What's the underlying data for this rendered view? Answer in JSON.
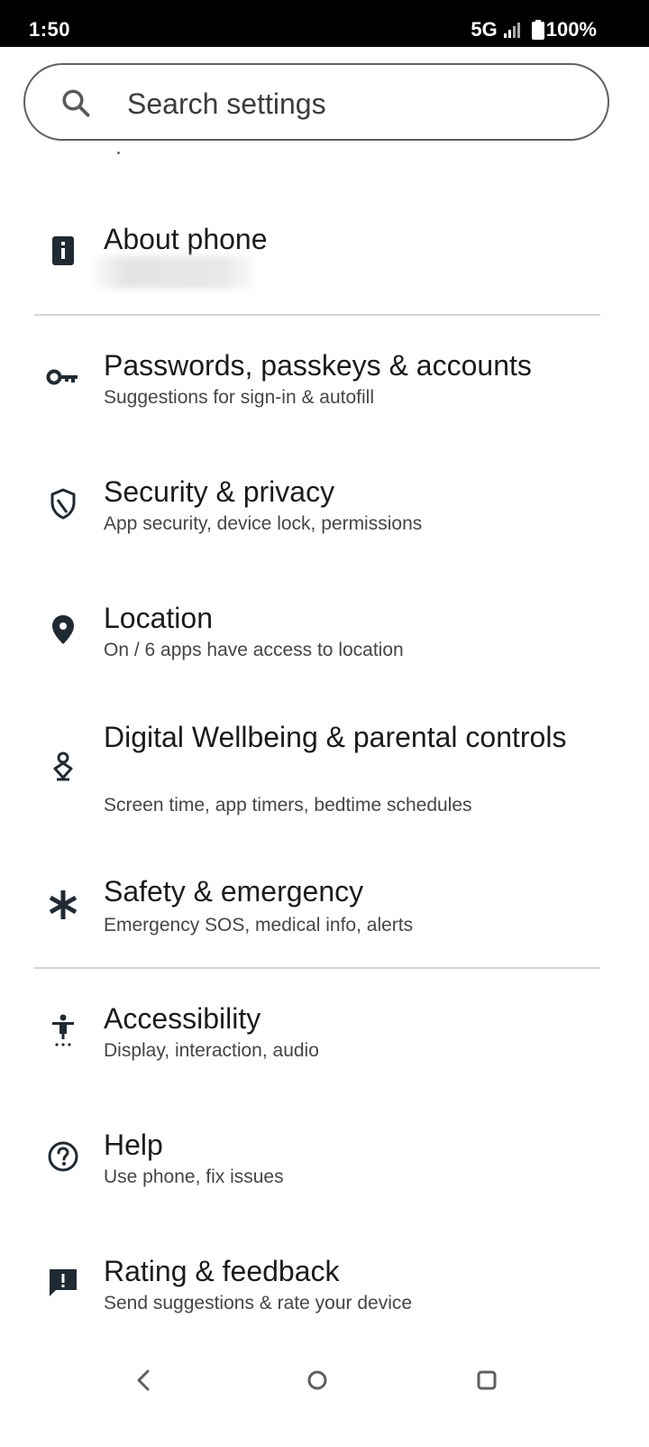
{
  "status_bar": {
    "time": "1:50",
    "network": "5G",
    "battery": "100%"
  },
  "search": {
    "placeholder": "Search settings"
  },
  "items": [
    {
      "title": "About phone",
      "subtitle": "",
      "icon": "info-icon"
    },
    {
      "title": "Passwords, passkeys & accounts",
      "subtitle": "Suggestions for sign-in & autofill",
      "icon": "key-icon"
    },
    {
      "title": "Security & privacy",
      "subtitle": "App security, device lock, permissions",
      "icon": "shield-icon"
    },
    {
      "title": "Location",
      "subtitle": "On / 6 apps have access to location",
      "icon": "location-pin-icon"
    },
    {
      "title": "Digital Wellbeing & parental controls",
      "subtitle": "Screen time, app timers, bedtime schedules",
      "icon": "wellbeing-icon"
    },
    {
      "title": "Safety & emergency",
      "subtitle": "Emergency SOS, medical info, alerts",
      "icon": "asterisk-icon"
    },
    {
      "title": "Accessibility",
      "subtitle": "Display, interaction, audio",
      "icon": "accessibility-icon"
    },
    {
      "title": "Help",
      "subtitle": "Use phone, fix issues",
      "icon": "help-icon"
    },
    {
      "title": "Rating & feedback",
      "subtitle": "Send suggestions & rate your device",
      "icon": "feedback-icon"
    }
  ],
  "nav": {
    "back": "back-icon",
    "home": "home-icon",
    "recents": "recents-icon"
  }
}
